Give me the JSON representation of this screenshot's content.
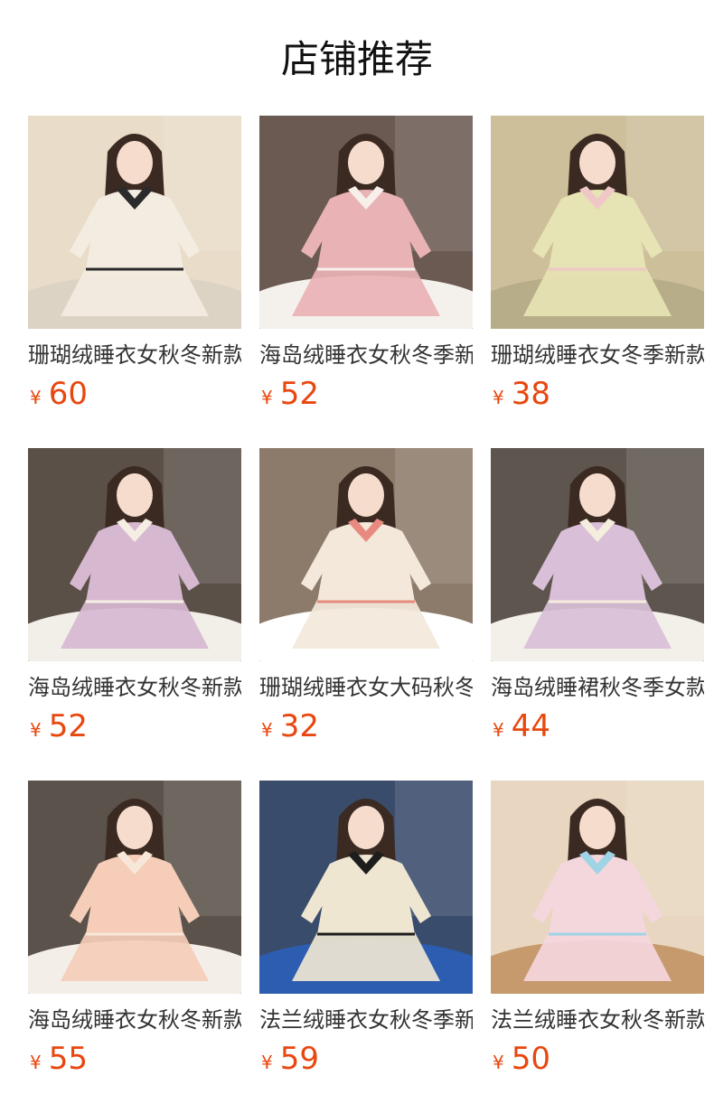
{
  "header": {
    "title": "店铺推荐"
  },
  "colors": {
    "price": "#e8470f",
    "title": "#111111",
    "item_text": "#333333"
  },
  "currency": "¥",
  "products": [
    {
      "title": "珊瑚绒睡衣女秋冬新款",
      "price": "60",
      "bg": "#e9dcc8",
      "garment": "#f3ece0",
      "accent": "#2b2b2b",
      "floor": "#ddd3c4"
    },
    {
      "title": "海岛绒睡衣女秋冬季新款",
      "price": "52",
      "bg": "#6b5a52",
      "garment": "#e9b2b5",
      "accent": "#f7efe9",
      "floor": "#f4f1ec"
    },
    {
      "title": "珊瑚绒睡衣女冬季新款",
      "price": "38",
      "bg": "#cdbf9a",
      "garment": "#e6e3b4",
      "accent": "#f0c7c7",
      "floor": "#b8ad89"
    },
    {
      "title": "海岛绒睡衣女秋冬新款",
      "price": "52",
      "bg": "#5b5048",
      "garment": "#d7b8d1",
      "accent": "#f4eee3",
      "floor": "#f2efe9"
    },
    {
      "title": "珊瑚绒睡衣女大码秋冬",
      "price": "32",
      "bg": "#8c7b6a",
      "garment": "#f3e8da",
      "accent": "#e98a80",
      "floor": "#ffffff"
    },
    {
      "title": "海岛绒睡裙秋冬季女款",
      "price": "44",
      "bg": "#5e564e",
      "garment": "#d9bfd7",
      "accent": "#f5eddd",
      "floor": "#f3f0ea"
    },
    {
      "title": "海岛绒睡衣女秋冬新款",
      "price": "55",
      "bg": "#5b524b",
      "garment": "#f5cdb8",
      "accent": "#f7e7d8",
      "floor": "#f3efe8"
    },
    {
      "title": "法兰绒睡衣女秋冬季新款",
      "price": "59",
      "bg": "#3a4c6b",
      "garment": "#efe6d2",
      "accent": "#1d1d1d",
      "floor": "#2d5db0"
    },
    {
      "title": "法兰绒睡衣女秋冬新款",
      "price": "50",
      "bg": "#e8d6c0",
      "garment": "#f4d6dd",
      "accent": "#9fd3e6",
      "floor": "#c69a6c"
    }
  ]
}
